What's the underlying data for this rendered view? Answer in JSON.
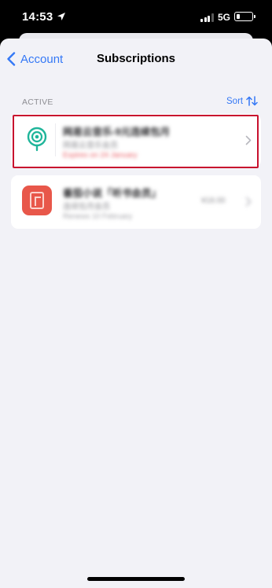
{
  "status_bar": {
    "time": "14:53",
    "network": "5G",
    "signal_bars_active": 3
  },
  "nav": {
    "back_label": "Account",
    "title": "Subscriptions"
  },
  "section": {
    "header": "ACTIVE",
    "sort_label": "Sort"
  },
  "subscriptions": [
    {
      "title": "网易云音乐-9元连续包月",
      "line2": "网易云音乐会员",
      "line3": "Expires on 24 January",
      "icon": "netease-music-icon",
      "highlighted": true
    },
    {
      "title": "番茄小说「听书会员」",
      "line2": "连续包月会员",
      "line3": "Renews 10 February",
      "price": "¥18.00",
      "icon": "book-icon",
      "highlighted": false
    }
  ],
  "colors": {
    "accent": "#3478f6",
    "highlight_border": "#c8102e",
    "expiry_text": "#ea5a61",
    "background": "#f2f2f7"
  }
}
